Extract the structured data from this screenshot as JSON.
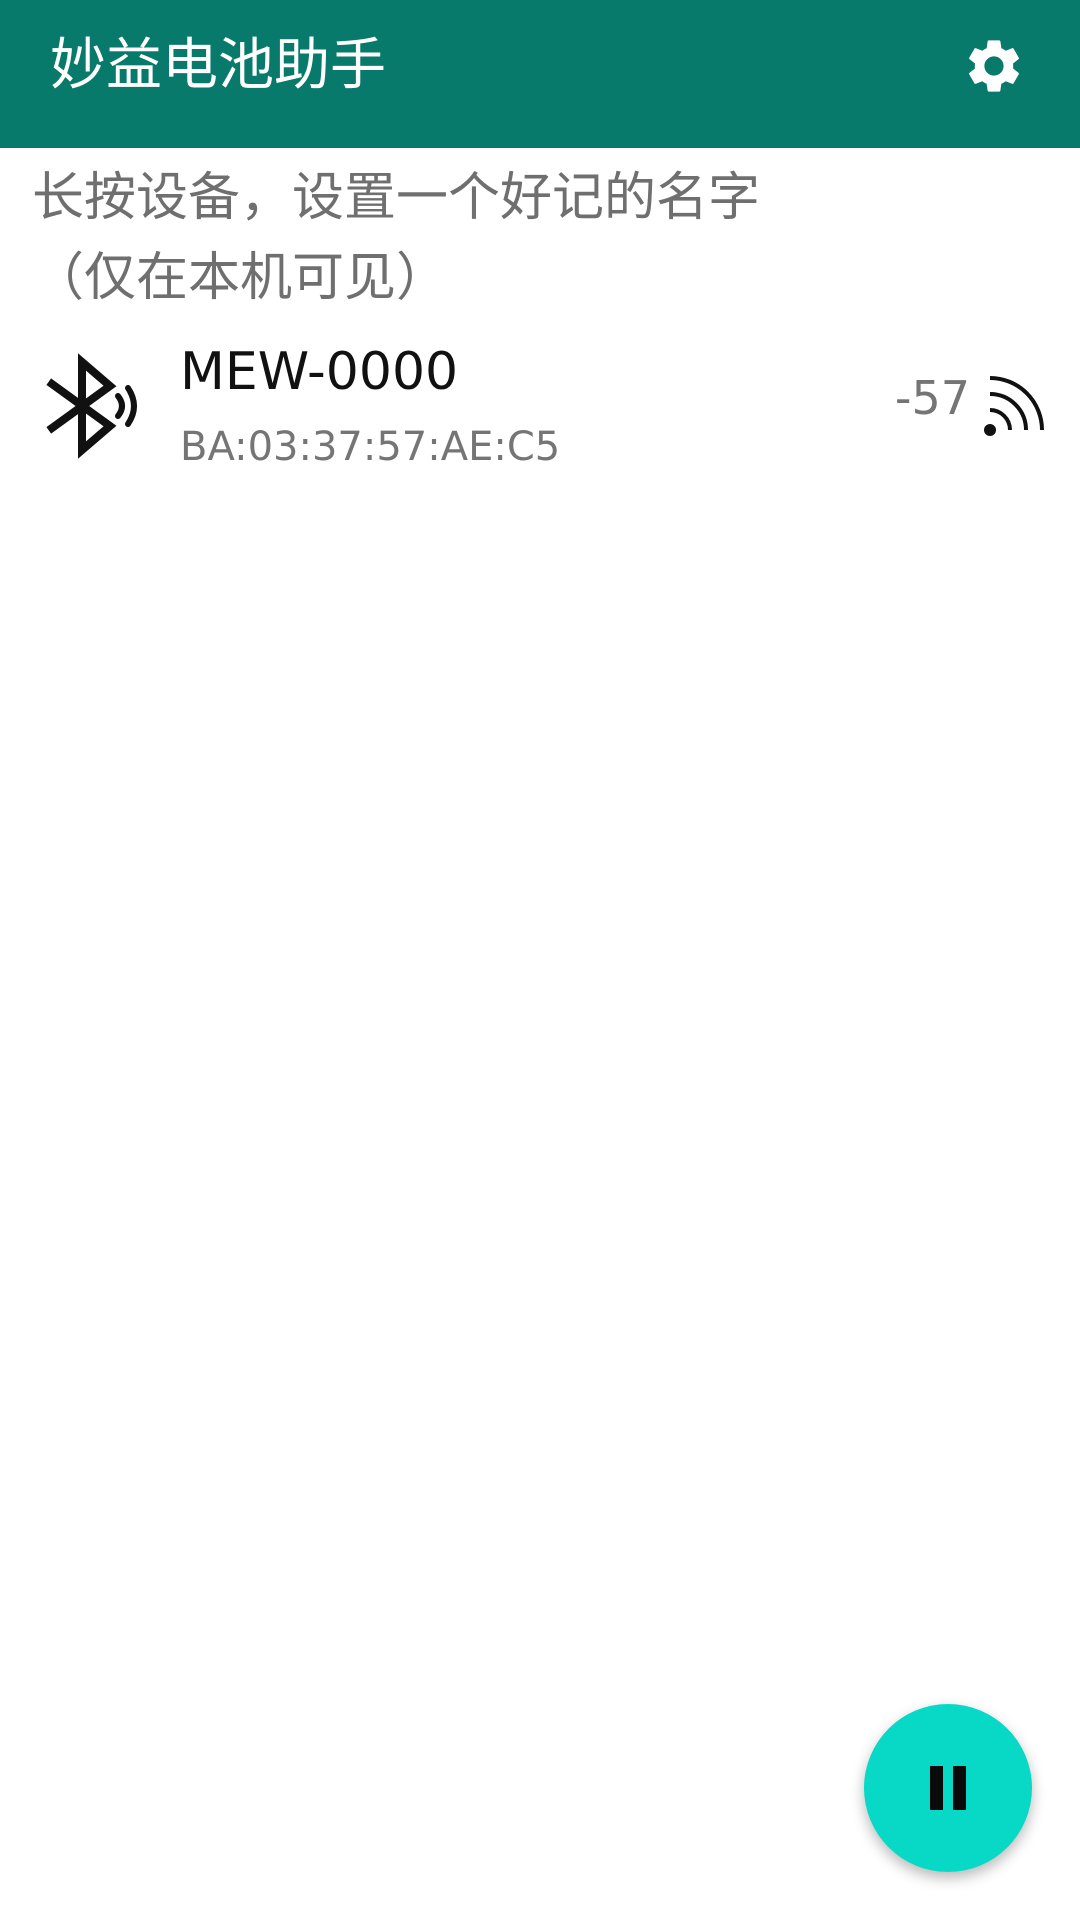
{
  "app_bar": {
    "title": "妙益电池助手",
    "settings_icon": "gear-icon",
    "background_color": "#087A6B"
  },
  "hint": {
    "line1": "长按设备，设置一个好记的名字",
    "line2": "（仅在本机可见）"
  },
  "devices": [
    {
      "name": "MEW-0000",
      "mac": "BA:03:37:57:AE:C5",
      "rssi": "-57",
      "icon": "bluetooth-searching-icon",
      "signal_icon": "signal-strength-icon"
    }
  ],
  "fab": {
    "icon": "pause-icon",
    "color": "#08D9C6"
  }
}
